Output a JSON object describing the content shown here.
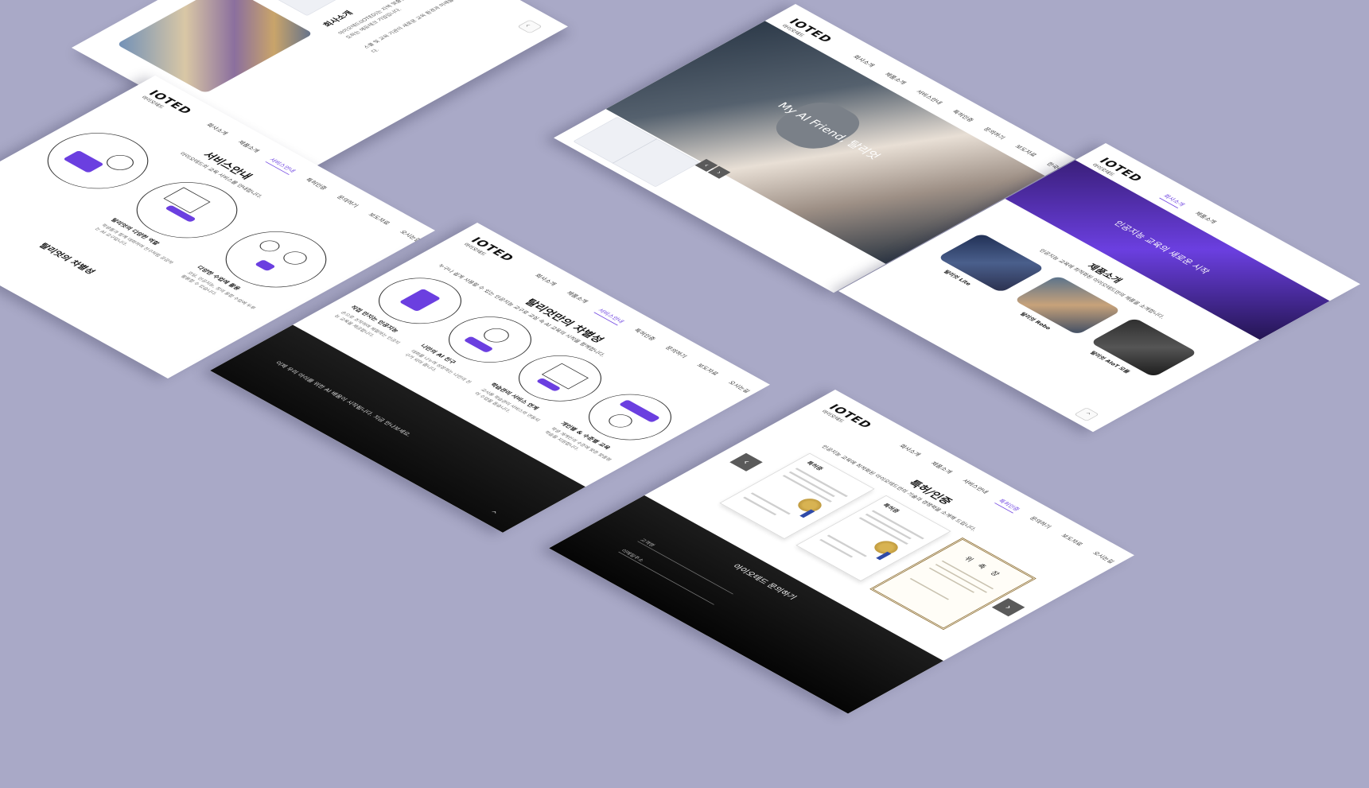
{
  "background_color": "#a9a9c7",
  "accent_color": "#6b3fe0",
  "brand": {
    "logo": "IOTED",
    "logo_sub": "아이오테드"
  },
  "nav": {
    "items": [
      "회사소개",
      "제품소개",
      "서비스안내",
      "특허인증",
      "문의하기",
      "보도자료",
      "오시는길"
    ],
    "lang": "한국어"
  },
  "hero": {
    "headline": "My AI Friend, 탈리엇"
  },
  "company": {
    "title": "회사소개",
    "lines": [
      "아이오테드(IOTED)는 지역 맞춤형 AIoT 융합 교육을 선도하는 에듀테크 기업입니다.",
      "스쿨 및 교육 기관의 새로운 교육 환경과 미래를 고민합니다."
    ]
  },
  "service": {
    "title": "서비스안내",
    "desc": "아이오테드의 교육 서비스를 안내합니다.",
    "items": [
      {
        "title": "탈리엇의 다양한 역할",
        "text": "학생들과 함께 대화하며 친구처럼 공감하는 AI 교구입니다."
      },
      {
        "title": "다양한 수업에 활용",
        "text": "코딩, 인공지능, 창의 융합 수업에 두루 활용할 수 있습니다."
      }
    ],
    "section2": "탈리엇의 차별성"
  },
  "diff": {
    "title": "탈리엇만의 차별성",
    "desc": "누구나 쉽게 사용할 수 있는 인공지능 교구로 교실 속 AI 교육의 시작을 함께합니다.",
    "items": [
      {
        "title": "직접 만지는 인공지능",
        "text": "손으로 조작하며 체험하는 인공지능 교육을 제공합니다."
      },
      {
        "title": "나만의 AI 친구",
        "text": "대화를 나누며 성장하는 나만의 친구가 되어 줍니다."
      },
      {
        "title": "학습관리 서비스 연계",
        "text": "교사용 학습관리 서비스와 연동되어 수업을 돕습니다."
      },
      {
        "title": "개인별 & 수준별 교육",
        "text": "학생 개개인의 수준에 맞춘 맞춤형 학습을 지원합니다."
      }
    ],
    "footer": "이제 우리 아이를 위한 AI 배움이 시작됩니다. 지금 만나보세요."
  },
  "products": {
    "title": "제품소개",
    "desc": "인공지능 교육에 최적화된 아이오테드만의 제품을 소개합니다.",
    "banner": "인공지능 교육의 새로운 시작",
    "items": [
      {
        "name": "탈리엇 Lite"
      },
      {
        "name": "탈리엇 Robo"
      },
      {
        "name": "탈리엇 AIoT 모듈"
      }
    ]
  },
  "patents": {
    "title": "특허/인증",
    "desc": "인공지능 교육에 최적화된 아이오테드만의 기술과 경쟁력을 소개해 드립니다.",
    "cert_label": "특허증",
    "award_label": "위 촉 장",
    "prev": "‹",
    "next": "›"
  },
  "contact": {
    "title": "아이오테드 문의하기",
    "fields": [
      "고객명",
      "이메일주소"
    ]
  },
  "ui": {
    "top": "^",
    "slide_prev": "‹",
    "slide_next": "›"
  }
}
